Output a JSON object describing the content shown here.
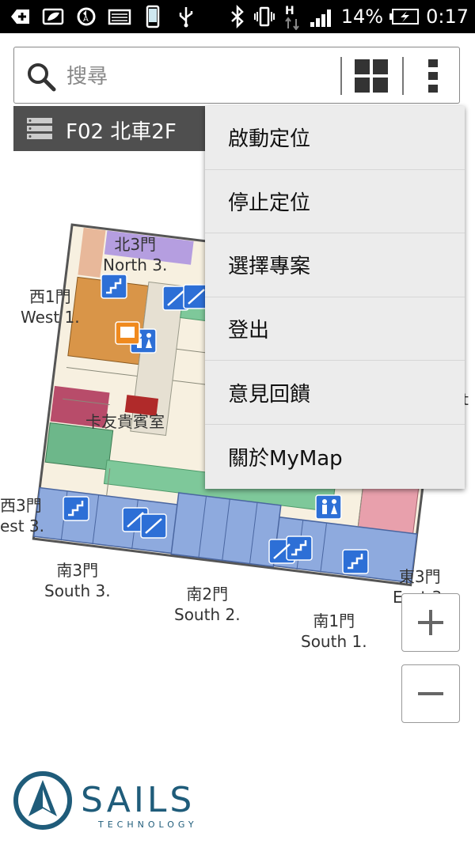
{
  "status_bar": {
    "battery": "14%",
    "time": "0:17"
  },
  "search": {
    "placeholder": "搜尋"
  },
  "floor": {
    "label": "F02 北車2F"
  },
  "menu": {
    "items": [
      {
        "label": "啟動定位"
      },
      {
        "label": "停止定位"
      },
      {
        "label": "選擇專案"
      },
      {
        "label": "登出"
      },
      {
        "label": "意見回饋"
      },
      {
        "label": "關於MyMap"
      }
    ]
  },
  "map": {
    "labels": {
      "north3_zh": "北3門",
      "north3_en": "North 3.",
      "west1_zh": "西1門",
      "west1_en": "West 1.",
      "vip_room": "卡友貴賓室",
      "west3_zh": "西3門",
      "west3_en": "est 3.",
      "south3_zh": "南3門",
      "south3_en": "South 3.",
      "south2_zh": "南2門",
      "south2_en": "South 2.",
      "south1_zh": "南1門",
      "south1_en": "South 1.",
      "east3_zh": "東3門",
      "east3_en": "East 3.",
      "east_partial": "t"
    }
  },
  "zoom": {
    "in_label": "+",
    "out_label": "−"
  },
  "logo": {
    "name": "SAILS",
    "tagline": "TECHNOLOGY"
  },
  "colors": {
    "menu_bg": "#ececec",
    "floor_bar": "#4f4f4f",
    "map_blue": "#8eaade",
    "map_green": "#7ec89a",
    "map_orange": "#d99548",
    "map_pink": "#e8a0ac",
    "map_magenta": "#b84c6a",
    "icon_blue": "#2d6fd6",
    "logo_teal": "#1f5c7a"
  }
}
